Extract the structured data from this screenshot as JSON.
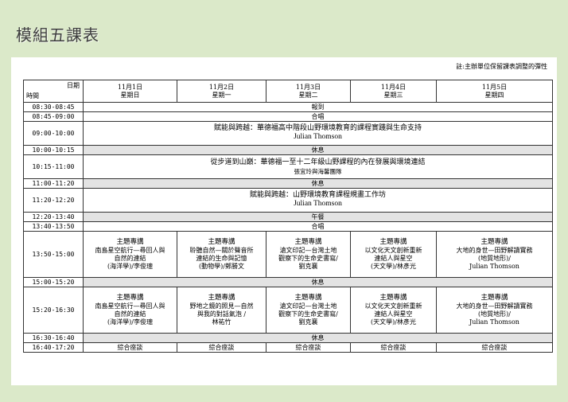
{
  "page_title": "模組五課表",
  "note": "註:主辦單位保留課表調整的彈性",
  "header": {
    "corner_top": "日期",
    "corner_bottom": "時間",
    "days": [
      {
        "date": "11月1日",
        "weekday": "星期日"
      },
      {
        "date": "11月2日",
        "weekday": "星期一"
      },
      {
        "date": "11月3日",
        "weekday": "星期二"
      },
      {
        "date": "11月4日",
        "weekday": "星期三"
      },
      {
        "date": "11月5日",
        "weekday": "星期四"
      }
    ]
  },
  "rows": {
    "r1": {
      "time": "08:30-08:45",
      "text": "報到"
    },
    "r2": {
      "time": "08:45-09:00",
      "text": "合唱"
    },
    "r3": {
      "time": "09:00-10:00",
      "text": "賦能與跨越：華德福高中階段山野環境教育的課程實踐與生命支持",
      "speaker": "Julian Thomson"
    },
    "r4": {
      "time": "10:00-10:15",
      "text": "休息"
    },
    "r5": {
      "time": "10:15-11:00",
      "text": "從步道到山巔：華德福一至十二年級山野課程的內在發展與環境連結",
      "sub": "張宜玲與海馨團隊"
    },
    "r6": {
      "time": "11:00-11:20",
      "text": "休息"
    },
    "r7": {
      "time": "11:20-12:20",
      "text": "賦能與跨越：山野環境教育課程規畫工作坊",
      "speaker": "Julian Thomson"
    },
    "r8": {
      "time": "12:20-13:40",
      "text": "午餐"
    },
    "r9": {
      "time": "13:40-13:50",
      "text": "合唱"
    },
    "r10": {
      "time": "13:50-15:00",
      "cells": [
        {
          "kw": "主題專講",
          "l1": "南島星空航行—尋回人與",
          "l2": "自然的連結",
          "l3": "(海洋學)/李俊璁"
        },
        {
          "kw": "主題專講",
          "l1": "聆聽自然—關於聲音所",
          "l2": "連結的生命與記憶",
          "l3": "(動物學)/鄭勝文"
        },
        {
          "kw": "主題專講",
          "l1": "滄文印記—台灣土地",
          "l2": "觀察下的生命史書寫/",
          "l3": "劉克襄"
        },
        {
          "kw": "主題專講",
          "l1": "以文化天文創新重新",
          "l2": "連結人與星空",
          "l3": "(天文學)/林彥光"
        },
        {
          "kw": "主題專講",
          "l1": "大地的身世—田野解讀實務",
          "l2": "(地質地形)/",
          "l3": "Julian Thomson"
        }
      ]
    },
    "r11": {
      "time": "15:00-15:20",
      "text": "休息"
    },
    "r12": {
      "time": "15:20-16:30",
      "cells": [
        {
          "kw": "主題專講",
          "l1": "南島星空航行—尋回人與",
          "l2": "自然的連結",
          "l3": "(海洋學)/李俊璁"
        },
        {
          "kw": "主題專講",
          "l1": "野地之鏡的照見—自然",
          "l2": "與我的對話氣泡 /",
          "l3": "林祐竹"
        },
        {
          "kw": "主題專講",
          "l1": "滄文印記—台灣土地",
          "l2": "觀察下的生命史書寫/",
          "l3": "劉克襄"
        },
        {
          "kw": "主題專講",
          "l1": "以文化天文創新重新",
          "l2": "連結人與星空",
          "l3": "(天文學)/林彥光"
        },
        {
          "kw": "主題專講",
          "l1": "大地的身世—田野解讀實務",
          "l2": "(地質地形)/",
          "l3": "Julian Thomson"
        }
      ]
    },
    "r13": {
      "time": "16:30-16:40",
      "text": "休息"
    },
    "r14": {
      "time": "16:40-17:20",
      "cells": [
        "綜合座談",
        "綜合座談",
        "綜合座談",
        "綜合座談",
        "綜合座談"
      ]
    }
  }
}
